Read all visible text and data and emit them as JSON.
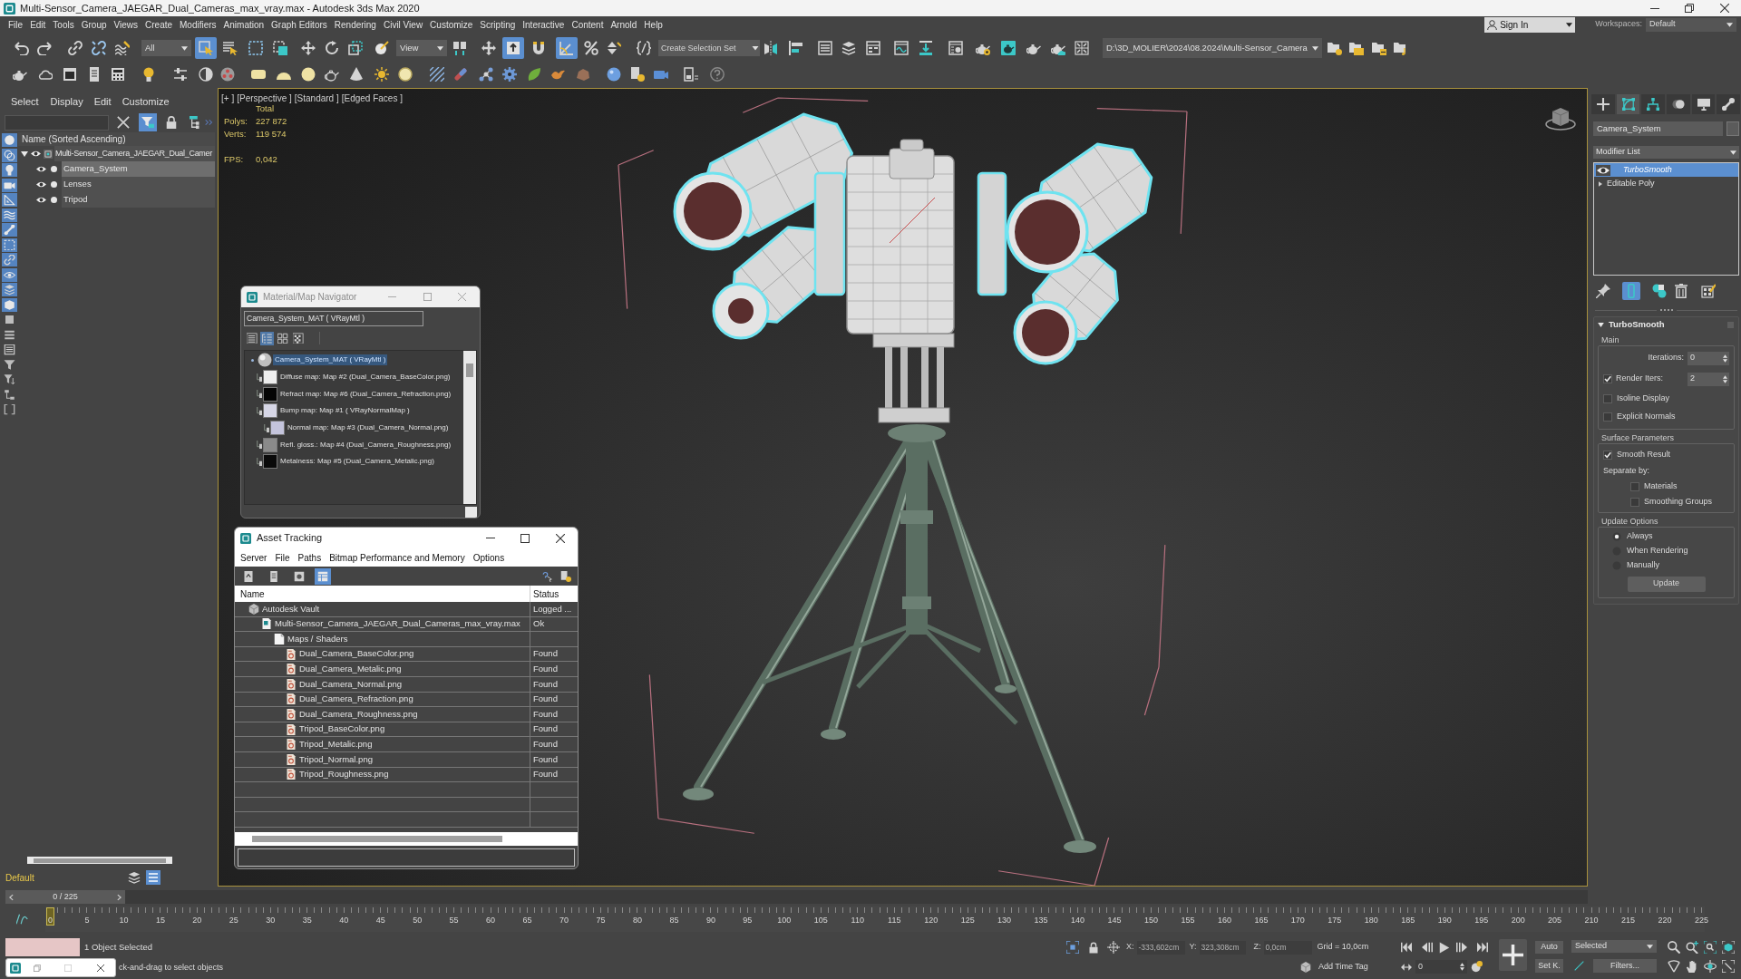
{
  "window": {
    "title": "Multi-Sensor_Camera_JAEGAR_Dual_Cameras_max_vray.max - Autodesk 3ds Max 2020"
  },
  "menu_bar": [
    "File",
    "Edit",
    "Tools",
    "Group",
    "Views",
    "Create",
    "Modifiers",
    "Animation",
    "Graph Editors",
    "Rendering",
    "Civil View",
    "Customize",
    "Scripting",
    "Interactive",
    "Content",
    "Arnold",
    "Help"
  ],
  "account": {
    "sign_in": "Sign In",
    "workspaces_label": "Workspaces:",
    "workspace": "Default"
  },
  "main_toolbar": [
    {
      "kind": "button",
      "selected": false
    },
    {
      "kind": "button",
      "selected": false
    },
    {
      "kind": "button",
      "selected": false
    },
    {
      "kind": "button",
      "selected": false
    },
    {
      "kind": "button",
      "selected": false
    },
    {
      "kind": "dropdown",
      "value": "All"
    },
    {
      "kind": "button",
      "selected": true
    },
    {
      "kind": "button",
      "selected": false
    },
    {
      "kind": "button",
      "selected": false
    },
    {
      "kind": "button",
      "selected": false
    },
    {
      "kind": "button",
      "selected": false
    },
    {
      "kind": "button",
      "selected": false
    },
    {
      "kind": "button",
      "selected": false
    },
    {
      "kind": "button",
      "selected": false
    },
    {
      "kind": "dropdown",
      "value": "View"
    },
    {
      "kind": "button",
      "selected": false
    },
    {
      "kind": "button",
      "selected": false
    },
    {
      "kind": "button",
      "selected": true
    },
    {
      "kind": "button",
      "selected": false
    },
    {
      "kind": "button",
      "selected": true
    },
    {
      "kind": "button",
      "selected": false
    },
    {
      "kind": "button",
      "selected": false
    },
    {
      "kind": "button",
      "selected": false
    },
    {
      "kind": "combo",
      "placeholder": "Create Selection Set"
    },
    {
      "kind": "button",
      "selected": false
    },
    {
      "kind": "button",
      "selected": false
    },
    {
      "kind": "button",
      "selected": false
    },
    {
      "kind": "button",
      "selected": false
    },
    {
      "kind": "button",
      "selected": false
    },
    {
      "kind": "button",
      "selected": false
    },
    {
      "kind": "button",
      "selected": false
    },
    {
      "kind": "button",
      "selected": false
    },
    {
      "kind": "button",
      "selected": false
    },
    {
      "kind": "button",
      "selected": false
    },
    {
      "kind": "button",
      "selected": false
    },
    {
      "kind": "button",
      "selected": false
    },
    {
      "kind": "button",
      "selected": false
    },
    {
      "kind": "path",
      "value": "D:\\3D_MOLIER\\2024\\08.2024\\Multi-Sensor_Camera"
    },
    {
      "kind": "button",
      "selected": false
    },
    {
      "kind": "button",
      "selected": false
    },
    {
      "kind": "button",
      "selected": false
    },
    {
      "kind": "button",
      "selected": false
    }
  ],
  "scene_explorer": {
    "menu": [
      "Select",
      "Display",
      "Edit",
      "Customize"
    ],
    "tools": [
      {
        "selected": false
      },
      {
        "selected": true
      },
      {
        "selected": false
      },
      {
        "selected": false
      }
    ],
    "display_filters": [
      {
        "on": true
      },
      {
        "on": true
      },
      {
        "on": true
      },
      {
        "on": true
      },
      {
        "on": true
      },
      {
        "on": true
      },
      {
        "on": true
      },
      {
        "on": true
      },
      {
        "on": true
      },
      {
        "on": true
      },
      {
        "on": true
      },
      {
        "on": true
      },
      {
        "on": false
      },
      {
        "on": false
      },
      {
        "on": false
      },
      {
        "on": false
      },
      {
        "on": false
      },
      {
        "on": false
      },
      {
        "on": false
      }
    ],
    "column": "Name (Sorted Ascending)",
    "tree": [
      {
        "label": "Multi-Sensor_Camera_JAEGAR_Dual_Camer",
        "expanded": true,
        "selected": false,
        "children": [
          {
            "label": "Camera_System",
            "selected": true
          },
          {
            "label": "Lenses",
            "selected": false
          },
          {
            "label": "Tripod",
            "selected": false
          }
        ]
      }
    ],
    "layer": "Default"
  },
  "viewport": {
    "labels": [
      "[+ ]",
      "[Perspective ]",
      "[Standard ]",
      "[Edged Faces ]"
    ],
    "stats_header": "Total",
    "stats": [
      {
        "kind": "count",
        "label": "Polys:",
        "value": "227 872"
      },
      {
        "kind": "count",
        "label": "Verts:",
        "value": "119 574"
      },
      {
        "kind": "rate",
        "label": "FPS:",
        "value": "0,042"
      }
    ]
  },
  "material_navigator": {
    "title": "Material/Map Navigator",
    "name": "Camera_System_MAT ( VRayMtl )",
    "view_modes": [
      {
        "selected": false
      },
      {
        "selected": true
      },
      {
        "selected": false
      },
      {
        "selected": false
      }
    ],
    "tree": [
      {
        "label": "Camera_System_MAT ( VRayMtl )",
        "kind": "material",
        "selected": true,
        "children": [
          {
            "label": "Diffuse map: Map #2 (Dual_Camera_BaseColor.png)",
            "kind": "map",
            "selected": false,
            "color": "#eeeeee"
          },
          {
            "label": "Refract map: Map #6 (Dual_Camera_Refraction.png)",
            "kind": "map",
            "selected": false,
            "color": "#050505"
          },
          {
            "label": "Bump map: Map #1 ( VRayNormalMap )",
            "kind": "map",
            "selected": false,
            "color": "#d6d6e6",
            "children": [
              {
                "label": "Normal map: Map #3 (Dual_Camera_Normal.png)",
                "kind": "map",
                "selected": false,
                "color": "#c4c4dc"
              }
            ]
          },
          {
            "label": "Refl. gloss.: Map #4 (Dual_Camera_Roughness.png)",
            "kind": "map",
            "selected": false,
            "color": "#8a8a8a"
          },
          {
            "label": "Metalness: Map #5 (Dual_Camera_Metalic.png)",
            "kind": "map",
            "selected": false,
            "color": "#0a0a0a"
          }
        ]
      }
    ]
  },
  "asset_tracking": {
    "title": "Asset Tracking",
    "menu": [
      "Server",
      "File",
      "Paths",
      "Bitmap Performance and Memory",
      "Options"
    ],
    "toolbar": [
      {
        "selected": false
      },
      {
        "selected": false
      },
      {
        "selected": false
      },
      {
        "selected": true
      }
    ],
    "columns": [
      "Name",
      "Status"
    ],
    "rows": [
      {
        "name": "Autodesk Vault",
        "status": "Logged ...",
        "kind": "vault",
        "children": [
          {
            "name": "Multi-Sensor_Camera_JAEGAR_Dual_Cameras_max_vray.max",
            "status": "Ok",
            "kind": "scene",
            "children": [
              {
                "name": "Maps / Shaders",
                "kind": "folder",
                "children": [
                  {
                    "name": "Dual_Camera_BaseColor.png",
                    "status": "Found",
                    "kind": "bitmap"
                  },
                  {
                    "name": "Dual_Camera_Metalic.png",
                    "status": "Found",
                    "kind": "bitmap"
                  },
                  {
                    "name": "Dual_Camera_Normal.png",
                    "status": "Found",
                    "kind": "bitmap"
                  },
                  {
                    "name": "Dual_Camera_Refraction.png",
                    "status": "Found",
                    "kind": "bitmap"
                  },
                  {
                    "name": "Dual_Camera_Roughness.png",
                    "status": "Found",
                    "kind": "bitmap"
                  },
                  {
                    "name": "Tripod_BaseColor.png",
                    "status": "Found",
                    "kind": "bitmap"
                  },
                  {
                    "name": "Tripod_Metalic.png",
                    "status": "Found",
                    "kind": "bitmap"
                  },
                  {
                    "name": "Tripod_Normal.png",
                    "status": "Found",
                    "kind": "bitmap"
                  },
                  {
                    "name": "Tripod_Roughness.png",
                    "status": "Found",
                    "kind": "bitmap"
                  }
                ]
              }
            ]
          }
        ]
      }
    ]
  },
  "command_panel": {
    "tabs": [
      {
        "selected": false
      },
      {
        "selected": true
      },
      {
        "selected": false
      },
      {
        "selected": false
      },
      {
        "selected": false
      },
      {
        "selected": false
      }
    ],
    "object_name": "Camera_System",
    "modifier_list": "Modifier List",
    "stack": [
      {
        "label": "TurboSmooth",
        "kind": "modifier",
        "selected": true
      },
      {
        "label": "Editable Poly",
        "kind": "base",
        "selected": false
      }
    ],
    "stack_tools": [
      {
        "selected": false
      },
      {
        "selected": true
      },
      {
        "selected": false
      },
      {
        "selected": false
      },
      {
        "selected": false
      }
    ],
    "rollout": {
      "title": "TurboSmooth",
      "expanded": true,
      "groups": [
        {
          "title": "Main",
          "controls": [
            {
              "kind": "spinner",
              "label": "Iterations:",
              "value": "0"
            },
            {
              "kind": "check_spinner",
              "label": "Render Iters:",
              "checked": true,
              "value": "2"
            },
            {
              "kind": "checkbox",
              "label": "Isoline Display",
              "checked": false
            },
            {
              "kind": "checkbox",
              "label": "Explicit Normals",
              "checked": false
            }
          ]
        },
        {
          "title": "Surface Parameters",
          "controls": [
            {
              "kind": "checkbox",
              "label": "Smooth Result",
              "checked": true
            },
            {
              "kind": "text",
              "label": "Separate by:"
            },
            {
              "kind": "subcheckbox",
              "label": "Materials",
              "checked": false
            },
            {
              "kind": "subcheckbox",
              "label": "Smoothing Groups",
              "checked": false
            }
          ]
        },
        {
          "title": "Update Options",
          "controls": [
            {
              "kind": "radio",
              "label": "Always",
              "selected": true
            },
            {
              "kind": "radio",
              "label": "When Rendering",
              "selected": false
            },
            {
              "kind": "radio",
              "label": "Manually",
              "selected": false
            },
            {
              "kind": "button",
              "label": "Update"
            }
          ]
        }
      ]
    }
  },
  "timeline": {
    "slider": {
      "label": "0 / 225",
      "level": 0
    },
    "ticks": [
      "0",
      "5",
      "10",
      "15",
      "20",
      "25",
      "30",
      "35",
      "40",
      "45",
      "50",
      "55",
      "60",
      "65",
      "70",
      "75",
      "80",
      "85",
      "90",
      "95",
      "100",
      "105",
      "110",
      "115",
      "120",
      "125",
      "130",
      "135",
      "140",
      "145",
      "150",
      "155",
      "160",
      "165",
      "170",
      "175",
      "180",
      "185",
      "190",
      "195",
      "200",
      "205",
      "210",
      "215",
      "220",
      "225"
    ]
  },
  "status_bar": {
    "selection": "1 Object Selected",
    "prompt": "ck-and-drag to select objects",
    "coords": [
      {
        "axis": "X:",
        "value": "-333,602cm"
      },
      {
        "axis": "Y:",
        "value": "323,308cm"
      },
      {
        "axis": "Z:",
        "value": "0,0cm"
      }
    ],
    "grid": "Grid = 10,0cm",
    "time_tag": "Add Time Tag",
    "frame": "0",
    "auto_key": "Auto",
    "set_key": "Set K.",
    "key_filter": "Selected",
    "filters": "Filters..."
  }
}
